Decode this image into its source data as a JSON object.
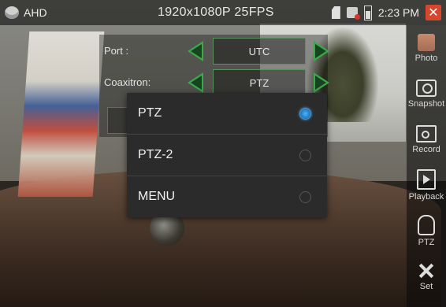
{
  "status_bar": {
    "mode": "AHD",
    "resolution": "1920x1080P 25FPS",
    "time": "2:23 PM",
    "close_symbol": "✕"
  },
  "settings_panel": {
    "port": {
      "label": "Port :",
      "value": "UTC"
    },
    "coaxitron": {
      "label": "Coaxitron:",
      "value": "PTZ"
    }
  },
  "popup_menu": {
    "options": [
      {
        "label": "PTZ",
        "selected": true
      },
      {
        "label": "PTZ-2",
        "selected": false
      },
      {
        "label": "MENU",
        "selected": false
      }
    ],
    "accent_color": "#3c9ad9"
  },
  "toolbar": {
    "items": [
      {
        "label": "Photo",
        "icon": "photo-icon"
      },
      {
        "label": "Snapshot",
        "icon": "camera-icon"
      },
      {
        "label": "Record",
        "icon": "record-icon"
      },
      {
        "label": "Playback",
        "icon": "playback-icon"
      },
      {
        "label": "PTZ",
        "icon": "ptz-dome-icon"
      },
      {
        "label": "Set",
        "icon": "tools-icon"
      }
    ]
  }
}
